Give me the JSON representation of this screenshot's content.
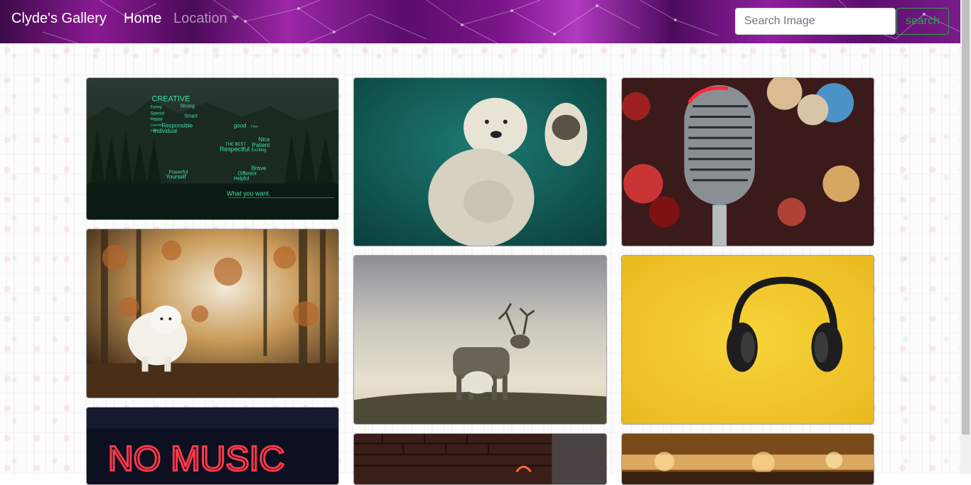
{
  "navbar": {
    "brand": "Clyde's Gallery",
    "home_label": "Home",
    "location_label": "Location"
  },
  "search": {
    "placeholder": "Search Image",
    "button_label": "search"
  },
  "gallery": {
    "images": [
      {
        "subject": "forest-lake-word-cloud",
        "words": [
          "CREATIVE",
          "Strong",
          "Funny",
          "Special",
          "Happy",
          "Smart",
          "Careful",
          "Calm",
          "Responsible",
          "Individual",
          "good",
          "Free",
          "Nice",
          "Patient",
          "Respectful",
          "THE BEST",
          "Exciting",
          "Brave",
          "Powerful",
          "Different",
          "Helpful",
          "Yourself"
        ],
        "caption": "What you want."
      },
      {
        "subject": "polar-bear-underwater"
      },
      {
        "subject": "vintage-microphone"
      },
      {
        "subject": "white-dog-autumn-forest"
      },
      {
        "subject": "reindeer-on-hill"
      },
      {
        "subject": "headphones-yellow-background"
      },
      {
        "subject": "neon-sign",
        "text": "NO MUSIC"
      },
      {
        "subject": "brick-wall-scene"
      },
      {
        "subject": "warm-bokeh-lights"
      }
    ]
  },
  "colors": {
    "navbar_purple": "#8a1a93",
    "search_button_green": "#28a745"
  }
}
